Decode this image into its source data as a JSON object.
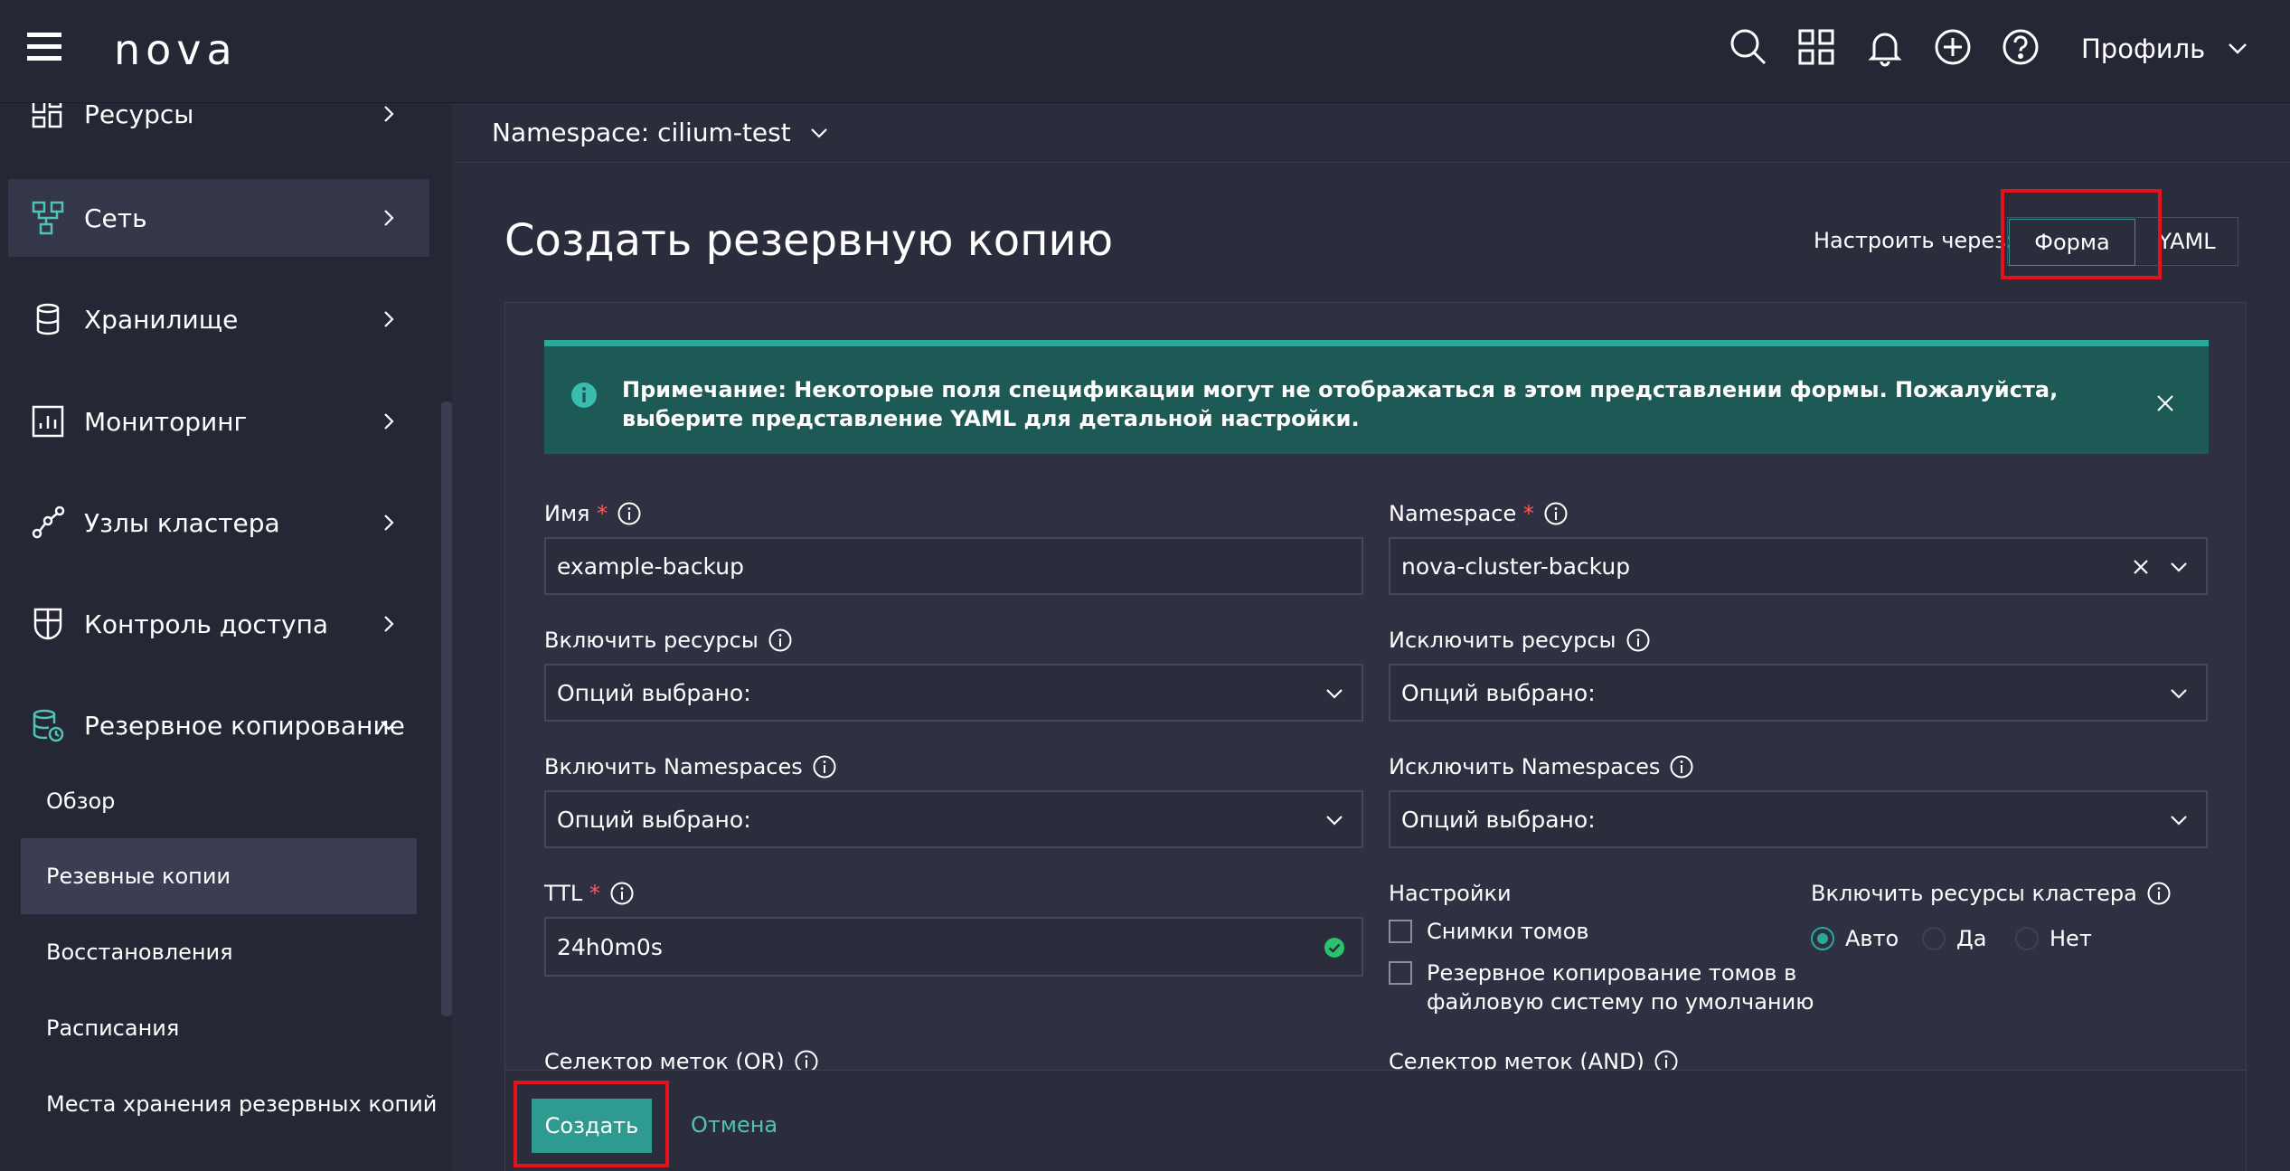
{
  "header": {
    "logo": "nova",
    "profile_label": "Профиль"
  },
  "sidebar": {
    "items": [
      {
        "label": "Ресурсы",
        "icon": "resources-icon"
      },
      {
        "label": "Сеть",
        "icon": "network-icon",
        "active": true
      },
      {
        "label": "Хранилище",
        "icon": "storage-icon"
      },
      {
        "label": "Мониторинг",
        "icon": "monitoring-icon"
      },
      {
        "label": "Узлы кластера",
        "icon": "cluster-nodes-icon"
      },
      {
        "label": "Контроль доступа",
        "icon": "access-control-icon"
      },
      {
        "label": "Резервное копирование",
        "icon": "backup-icon",
        "expanded": true
      }
    ],
    "subitems": [
      {
        "label": "Обзор"
      },
      {
        "label": "Резевные копии",
        "active": true
      },
      {
        "label": "Восстановления"
      },
      {
        "label": "Расписания"
      },
      {
        "label": "Места хранения резервных копий"
      }
    ]
  },
  "namespace_bar": {
    "label": "Namespace: cilium-test"
  },
  "page": {
    "title": "Создать резервную копию",
    "configure_label": "Настроить через:",
    "toggle_form": "Форма",
    "toggle_yaml": "YAML"
  },
  "notice": {
    "text": "Примечание: Некоторые поля спецификации могут не отображаться в этом представлении формы. Пожалуйста, выберите представление YAML для детальной настройки."
  },
  "form": {
    "name": {
      "label": "Имя",
      "required": "*",
      "value": "example-backup"
    },
    "namespace": {
      "label": "Namespace",
      "required": "*",
      "value": "nova-cluster-backup"
    },
    "include_resources": {
      "label": "Включить ресурсы",
      "value": "Опций выбрано:"
    },
    "exclude_resources": {
      "label": "Исключить ресурсы",
      "value": "Опций выбрано:"
    },
    "include_namespaces": {
      "label": "Включить Namespaces",
      "value": "Опций выбрано:"
    },
    "exclude_namespaces": {
      "label": "Исключить Namespaces",
      "value": "Опций выбрано:"
    },
    "ttl": {
      "label": "TTL",
      "required": "*",
      "value": "24h0m0s"
    },
    "settings": {
      "label": "Настройки",
      "volume_snapshots": "Снимки томов",
      "fs_backup_line1": "Резервное копирование томов в",
      "fs_backup_line2": "файловую систему по умолчанию"
    },
    "cluster_resources": {
      "label": "Включить ресурсы кластера",
      "options": [
        "Авто",
        "Да",
        "Нет"
      ],
      "selected": "Авто"
    },
    "label_selector_or": "Селектор меток (OR)",
    "label_selector_and": "Селектор меток (AND)"
  },
  "footer": {
    "create": "Создать",
    "cancel": "Отмена"
  },
  "colors": {
    "accent": "#2f9b90",
    "notice_bg": "#1e5a55",
    "highlight": "#e0131b",
    "required": "#ff5a5a",
    "valid": "#27c46b"
  }
}
